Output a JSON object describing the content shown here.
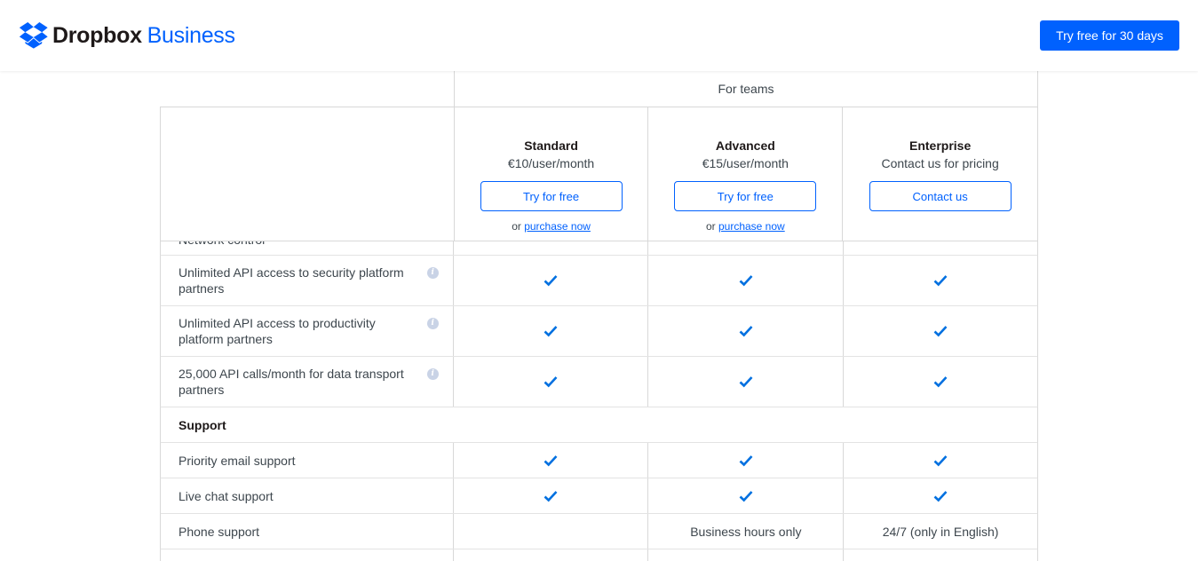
{
  "header": {
    "logo_word": "Dropbox",
    "logo_business": "Business",
    "logo_icon": "dropbox-logo-icon",
    "cta_label": "Try free for 30 days"
  },
  "table": {
    "group_label": "For teams",
    "plans": [
      {
        "name": "Standard",
        "price": "€10/user/month",
        "button": "Try for free",
        "purchase_prefix": "or",
        "purchase_link": "purchase now"
      },
      {
        "name": "Advanced",
        "price": "€15/user/month",
        "button": "Try for free",
        "purchase_prefix": "or",
        "purchase_link": "purchase now"
      },
      {
        "name": "Enterprise",
        "price": "Contact us for pricing",
        "button": "Contact us"
      }
    ],
    "partial_row": {
      "label": "Network control"
    },
    "api_rows": [
      {
        "label": "Unlimited API access to security platform partners"
      },
      {
        "label": "Unlimited API access to productivity platform partners"
      },
      {
        "label": "25,000 API calls/month for data transport partners"
      }
    ],
    "support_section": {
      "title": "Support",
      "rows": [
        {
          "label": "Priority email support"
        },
        {
          "label": "Live chat support"
        },
        {
          "label": "Phone support",
          "values": [
            "",
            "Business hours only",
            "24/7 (only in English)"
          ]
        }
      ]
    }
  },
  "colors": {
    "accent": "#0061fe",
    "text": "#3d464d",
    "heading": "#1e1919",
    "border": "#d8d8d8",
    "check": "#0070e0"
  }
}
